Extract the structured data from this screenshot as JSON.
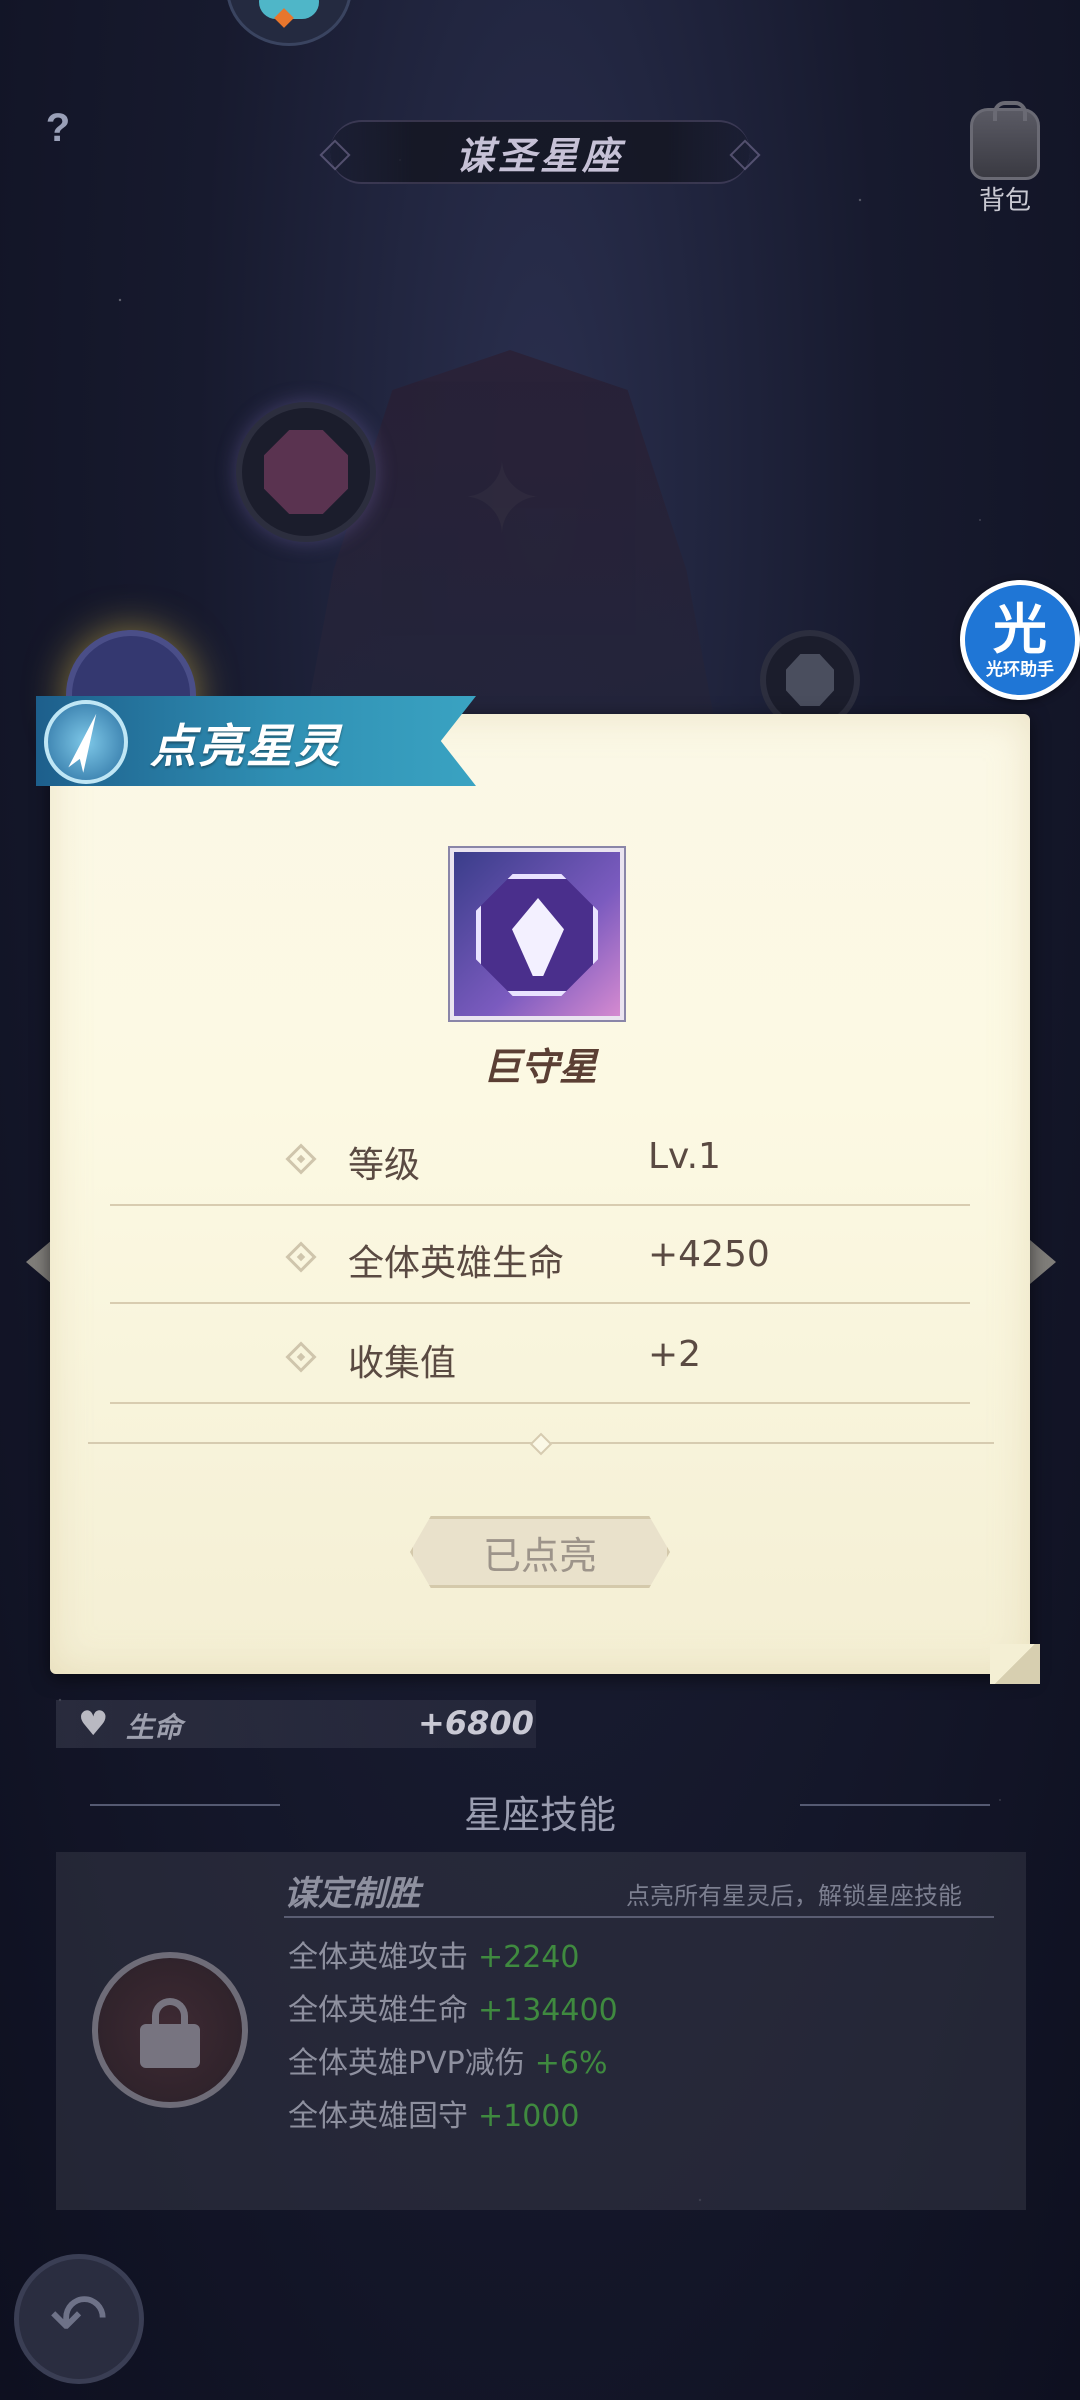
{
  "header": {
    "title": "谋圣星座",
    "help_label": "?",
    "bag_label": "背包"
  },
  "helper": {
    "big": "光",
    "small": "光环助手"
  },
  "dialog": {
    "banner_title": "点亮星灵",
    "spirit_name": "巨守星",
    "stats": [
      {
        "label": "等级",
        "value": "Lv.1"
      },
      {
        "label": "全体英雄生命",
        "value": "+4250"
      },
      {
        "label": "收集值",
        "value": "+2"
      }
    ],
    "button_label": "已点亮"
  },
  "life": {
    "label": "生命",
    "value": "+6800"
  },
  "skills": {
    "section_title": "星座技能",
    "skill_name": "谋定制胜",
    "hint": "点亮所有星灵后，解锁星座技能",
    "bonuses": [
      {
        "label": "全体英雄攻击",
        "value": "+2240"
      },
      {
        "label": "全体英雄生命",
        "value": "+134400"
      },
      {
        "label": "全体英雄PVP减伤",
        "value": "+6%"
      },
      {
        "label": "全体英雄固守",
        "value": "+1000"
      }
    ]
  },
  "colors": {
    "banner": "#2f8fb3",
    "bonus_value": "#3f8a3f",
    "parchment": "#fbf8e6"
  },
  "icons": [
    "question-icon",
    "backpack-icon",
    "spirit-emblem-icon",
    "diamond-bullet-icon",
    "heart-icon",
    "lock-icon",
    "back-arrow-icon"
  ]
}
